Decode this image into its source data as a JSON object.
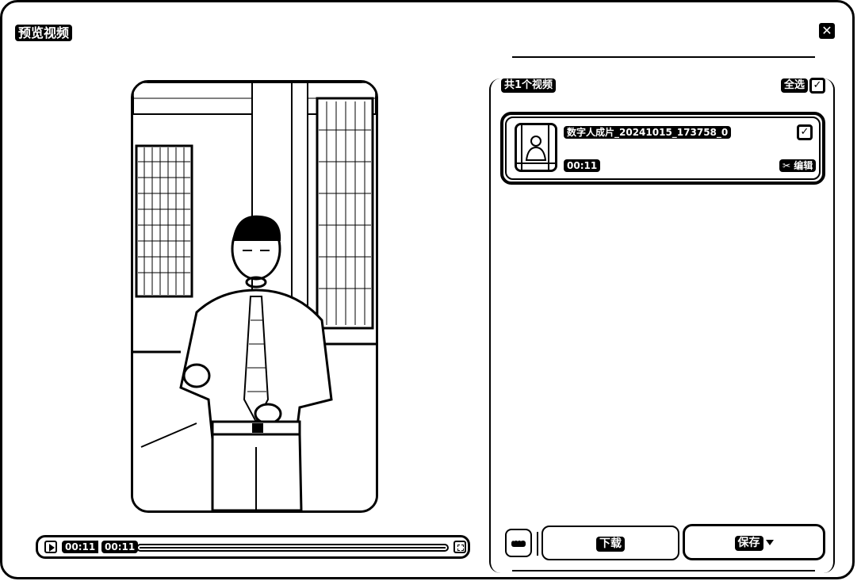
{
  "dialog": {
    "title": "预览视频",
    "close_icon": "close-icon"
  },
  "player": {
    "current_time": "00:11",
    "total_time": "00:11",
    "progress": 1.0
  },
  "list": {
    "count_label": "共1个视频",
    "select_all_label": "全选",
    "select_all_checked": true,
    "items": [
      {
        "name": "数字人成片_20241015_173758_0",
        "duration": "00:11",
        "edit_label": "编辑",
        "checked": true
      }
    ]
  },
  "actions": {
    "download_label": "下载",
    "save_label": "保存"
  }
}
